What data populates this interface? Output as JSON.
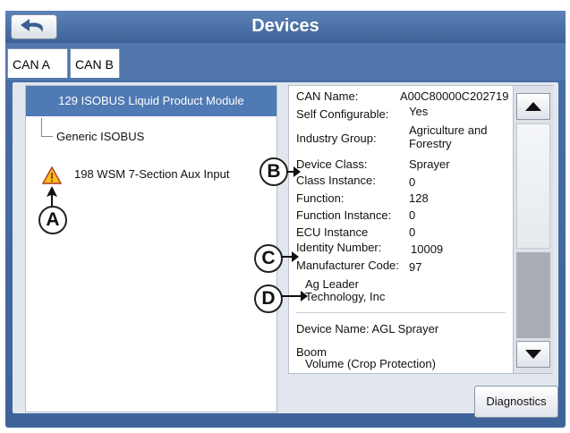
{
  "window": {
    "title": "Devices"
  },
  "tabs": [
    {
      "label": "CAN A"
    },
    {
      "label": "CAN B"
    }
  ],
  "device_list": {
    "items": [
      {
        "label": "129 ISOBUS Liquid Product Module",
        "selected": true
      },
      {
        "label": "Generic ISOBUS"
      },
      {
        "label": "198 WSM 7-Section Aux Input",
        "icon": "warning-icon"
      }
    ]
  },
  "details": {
    "fields": [
      {
        "label": "CAN Name:",
        "value": "A00C80000C202719"
      },
      {
        "label": "Self Configurable:",
        "value": "Yes"
      },
      {
        "label": "Industry Group:",
        "value": "Agriculture and Forestry"
      },
      {
        "label": "Device Class:",
        "value": "Sprayer"
      },
      {
        "label": "Class Instance:",
        "value": "0"
      },
      {
        "label": "Function:",
        "value": "128"
      },
      {
        "label": "Function Instance:",
        "value": "0"
      },
      {
        "label": "ECU Instance",
        "value": "0"
      },
      {
        "label": "Identity Number:",
        "value": "10009"
      },
      {
        "label": "Manufacturer Code:",
        "value": "97"
      }
    ],
    "manufacturer_name": "Ag Leader Technology, Inc",
    "device_name": "Device Name: AGL Sprayer",
    "boom_label": "Boom",
    "boom_value": "Volume (Crop Protection)"
  },
  "buttons": {
    "diagnostics": "Diagnostics"
  },
  "callouts": [
    "A",
    "B",
    "C",
    "D"
  ],
  "colors": {
    "accent": "#4f7ab3",
    "frame": "#3f649a"
  }
}
